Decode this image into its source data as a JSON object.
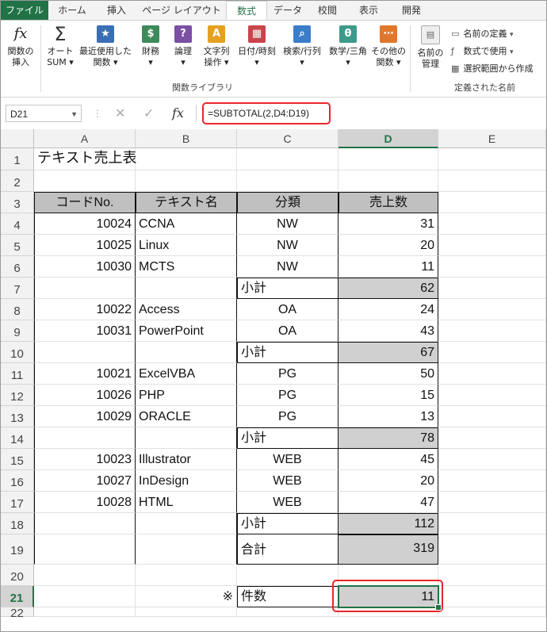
{
  "tabs": [
    {
      "label": "ファイル",
      "kind": "file"
    },
    {
      "label": "ホーム"
    },
    {
      "label": "挿入"
    },
    {
      "label": "ページ レイアウト"
    },
    {
      "label": "数式",
      "active": true
    },
    {
      "label": "データ"
    },
    {
      "label": "校閲"
    },
    {
      "label": "表示"
    },
    {
      "label": "開発"
    }
  ],
  "ribbon": {
    "insert_function": {
      "icon": "fx-icon",
      "line1": "関数の",
      "line2": "挿入"
    },
    "autosum": {
      "icon": "sigma-icon",
      "line1": "オート",
      "line2": "SUM ▾"
    },
    "recent": {
      "icon": "star-icon",
      "line1": "最近使用した",
      "line2": "関数 ▾"
    },
    "financial": {
      "icon": "financial-icon",
      "line1": "財務",
      "line2": "▾"
    },
    "logical": {
      "icon": "logical-icon",
      "line1": "論理",
      "line2": "▾"
    },
    "text": {
      "icon": "text-icon",
      "line1": "文字列",
      "line2": "操作 ▾"
    },
    "datetime": {
      "icon": "calendar-icon",
      "line1": "日付/時刻",
      "line2": "▾"
    },
    "lookup": {
      "icon": "lookup-icon",
      "line1": "検索/行列",
      "line2": "▾"
    },
    "math": {
      "icon": "math-icon",
      "line1": "数学/三角",
      "line2": "▾"
    },
    "more": {
      "icon": "more-functions-icon",
      "line1": "その他の",
      "line2": "関数 ▾"
    },
    "library_group_label": "関数ライブラリ",
    "name_manager": {
      "icon": "name-manager-icon",
      "line1": "名前の",
      "line2": "管理"
    },
    "define_name": "名前の定義",
    "use_in_formula": "数式で使用",
    "create_from_selection": "選択範囲から作成",
    "names_group_label": "定義された名前",
    "icon_glyphs": {
      "fx": "fx",
      "sigma": "Σ",
      "star": "★",
      "financial": "$",
      "logical": "?",
      "text": "A",
      "calendar": "▦",
      "lookup": "⌕",
      "math": "θ",
      "more": "⋯"
    },
    "colors": {
      "star": "#3a6fb5",
      "financial": "#3d8a5b",
      "logical": "#7b4fa3",
      "text": "#e5a221",
      "calendar": "#c9444c",
      "lookup": "#3a7dc9",
      "math": "#3d9a8a",
      "more": "#e0782c"
    }
  },
  "formula_bar": {
    "name_box": "D21",
    "cancel_glyph": "✕",
    "enter_glyph": "✓",
    "fx_glyph": "fx",
    "formula": "=SUBTOTAL(2,D4:D19)"
  },
  "columns": [
    "A",
    "B",
    "C",
    "D",
    "E"
  ],
  "rows": [
    {
      "n": "1",
      "A": "テキスト売上表"
    },
    {
      "n": "2"
    },
    {
      "n": "3",
      "A": "コードNo.",
      "B": "テキスト名",
      "C": "分類",
      "D": "売上数"
    },
    {
      "n": "4",
      "A": "10024",
      "B": "CCNA",
      "C": "NW",
      "D": "31"
    },
    {
      "n": "5",
      "A": "10025",
      "B": "Linux",
      "C": "NW",
      "D": "20"
    },
    {
      "n": "6",
      "A": "10030",
      "B": "MCTS",
      "C": "NW",
      "D": "11"
    },
    {
      "n": "7",
      "C": "小計",
      "D": "62"
    },
    {
      "n": "8",
      "A": "10022",
      "B": "Access",
      "C": "OA",
      "D": "24"
    },
    {
      "n": "9",
      "A": "10031",
      "B": "PowerPoint",
      "C": "OA",
      "D": "43"
    },
    {
      "n": "10",
      "C": "小計",
      "D": "67"
    },
    {
      "n": "11",
      "A": "10021",
      "B": "ExcelVBA",
      "C": "PG",
      "D": "50"
    },
    {
      "n": "12",
      "A": "10026",
      "B": "PHP",
      "C": "PG",
      "D": "15"
    },
    {
      "n": "13",
      "A": "10029",
      "B": "ORACLE",
      "C": "PG",
      "D": "13"
    },
    {
      "n": "14",
      "C": "小計",
      "D": "78"
    },
    {
      "n": "15",
      "A": "10023",
      "B": "Illustrator",
      "C": "WEB",
      "D": "45"
    },
    {
      "n": "16",
      "A": "10027",
      "B": "InDesign",
      "C": "WEB",
      "D": "20"
    },
    {
      "n": "17",
      "A": "10028",
      "B": "HTML",
      "C": "WEB",
      "D": "47"
    },
    {
      "n": "18",
      "C": "小計",
      "D": "112"
    },
    {
      "n": "19",
      "C": "合計",
      "D": "319"
    },
    {
      "n": "20"
    },
    {
      "n": "21",
      "B": "※",
      "C": "件数",
      "D": "11"
    },
    {
      "n": "22"
    }
  ],
  "selected_cell": "D21"
}
